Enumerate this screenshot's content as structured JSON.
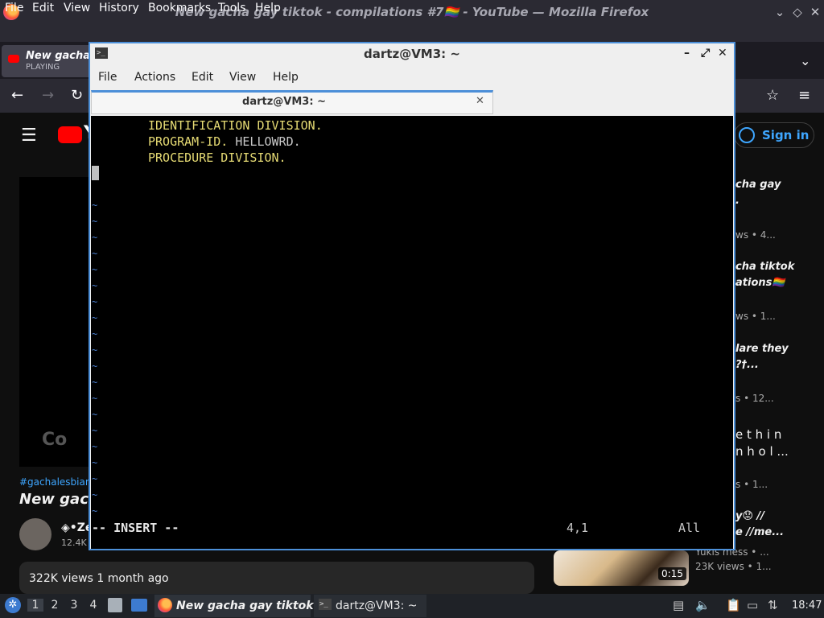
{
  "firefox": {
    "window_title": "New gacha gay tiktok - compilations #7🏳️‍🌈 - YouTube — Mozilla Firefox",
    "menu": [
      "File",
      "Edit",
      "View",
      "History",
      "Bookmarks",
      "Tools",
      "Help"
    ],
    "tab": {
      "title": "New gacha g",
      "status": "PLAYING"
    }
  },
  "youtube": {
    "logo_text": "Y",
    "signin_label": "Sign in",
    "player_watermark": "Co",
    "hashtags": "#gachalesbian #",
    "video_title": "New gach",
    "channel_name": "◈•Ze",
    "subscriber_count": "12.4K",
    "views_line": "322K views  1 month ago",
    "sidebar": [
      {
        "title1": "cha gay",
        "title2": ".",
        "meta": "ws • 4..."
      },
      {
        "title1": "cha tiktok",
        "title2": "ations🏳️‍🌈",
        "meta": "ws • 1..."
      },
      {
        "title1": "lare they",
        "title2": "?†...",
        "meta": "s • 12..."
      },
      {
        "title1": "e t h i n",
        "title2": "n h o l ...",
        "meta": "s • 1..."
      },
      {
        "title1": "y😟 //",
        "title2": "e //me...",
        "channel": "Yukis mess • ...",
        "meta": "23K views • 1..."
      }
    ],
    "thumb_duration": "0:15"
  },
  "terminal": {
    "window_title": "dartz@VM3: ~",
    "menu": [
      "File",
      "Actions",
      "Edit",
      "View",
      "Help"
    ],
    "tab_title": "dartz@VM3: ~",
    "lines": [
      {
        "kw": "IDENTIFICATION DIVISION.",
        "rest": ""
      },
      {
        "kw": "PROGRAM-ID.",
        "rest": " HELLOWRD."
      },
      {
        "kw": "PROCEDURE DIVISION.",
        "rest": ""
      }
    ],
    "tilde": "~",
    "status_mode": "-- INSERT --",
    "status_position": "4,1",
    "status_scroll": "All"
  },
  "taskbar": {
    "workspaces": [
      "1",
      "2",
      "3",
      "4"
    ],
    "firefox_label": "New gacha gay tiktok -...",
    "terminal_label": "dartz@VM3: ~",
    "clock": "18:47"
  }
}
